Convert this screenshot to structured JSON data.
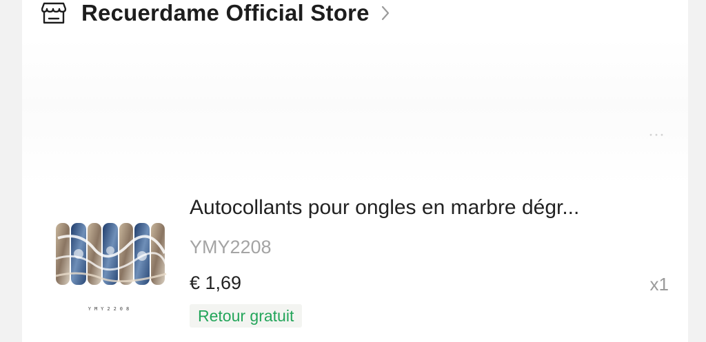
{
  "store": {
    "name": "Recuerdame Official Store",
    "icon": "store-icon",
    "chevron": "chevron-right-icon"
  },
  "product": {
    "title": "Autocollants pour ongles en marbre dégr...",
    "sku": "YMY2208",
    "thumb_code": "YMY2208",
    "price": "€ 1,69",
    "quantity": "x1",
    "badge": "Retour gratuit"
  },
  "colors": {
    "badge_text": "#23a55a",
    "badge_bg": "#f3f4f1",
    "sku_text": "#a4a4a4",
    "nail_blue": "#2e4f7f",
    "nail_beige": "#b9a48a"
  }
}
